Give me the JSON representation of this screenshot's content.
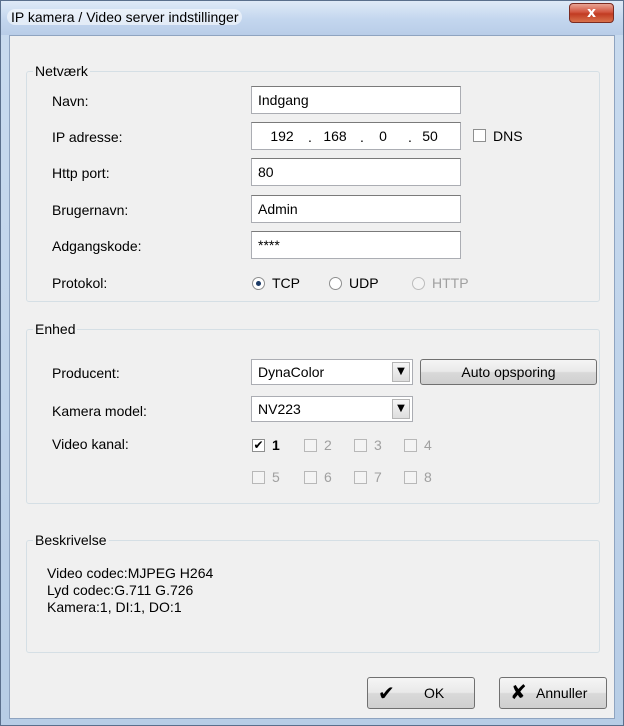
{
  "window": {
    "title": "IP kamera / Video server indstillinger",
    "close_glyph": "x"
  },
  "netvaerk": {
    "legend": "Netværk",
    "name_label": "Navn:",
    "name_value": "Indgang",
    "ip_label": "IP adresse:",
    "ip_octets": [
      "192",
      "168",
      "0",
      "50"
    ],
    "dns_label": "DNS",
    "dns_checked": false,
    "http_port_label": "Http port:",
    "http_port_value": "80",
    "username_label": "Brugernavn:",
    "username_value": "Admin",
    "password_label": "Adgangskode:",
    "password_value": "****",
    "protocol_label": "Protokol:",
    "protocols": [
      {
        "label": "TCP",
        "selected": true,
        "enabled": true
      },
      {
        "label": "UDP",
        "selected": false,
        "enabled": true
      },
      {
        "label": "HTTP",
        "selected": false,
        "enabled": false
      }
    ]
  },
  "enhed": {
    "legend": "Enhed",
    "manufacturer_label": "Producent:",
    "manufacturer_value": "DynaColor",
    "auto_detect_label": "Auto opsporing",
    "model_label": "Kamera model:",
    "model_value": "NV223",
    "channel_label": "Video kanal:",
    "channels": [
      {
        "label": "1",
        "checked": true,
        "enabled": true
      },
      {
        "label": "2",
        "checked": false,
        "enabled": false
      },
      {
        "label": "3",
        "checked": false,
        "enabled": false
      },
      {
        "label": "4",
        "checked": false,
        "enabled": false
      },
      {
        "label": "5",
        "checked": false,
        "enabled": false
      },
      {
        "label": "6",
        "checked": false,
        "enabled": false
      },
      {
        "label": "7",
        "checked": false,
        "enabled": false
      },
      {
        "label": "8",
        "checked": false,
        "enabled": false
      }
    ]
  },
  "beskrivelse": {
    "legend": "Beskrivelse",
    "lines": [
      "Video codec:MJPEG H264",
      "Lyd codec:G.711 G.726",
      "Kamera:1, DI:1, DO:1"
    ]
  },
  "buttons": {
    "ok_label": "OK",
    "cancel_label": "Annuller"
  }
}
